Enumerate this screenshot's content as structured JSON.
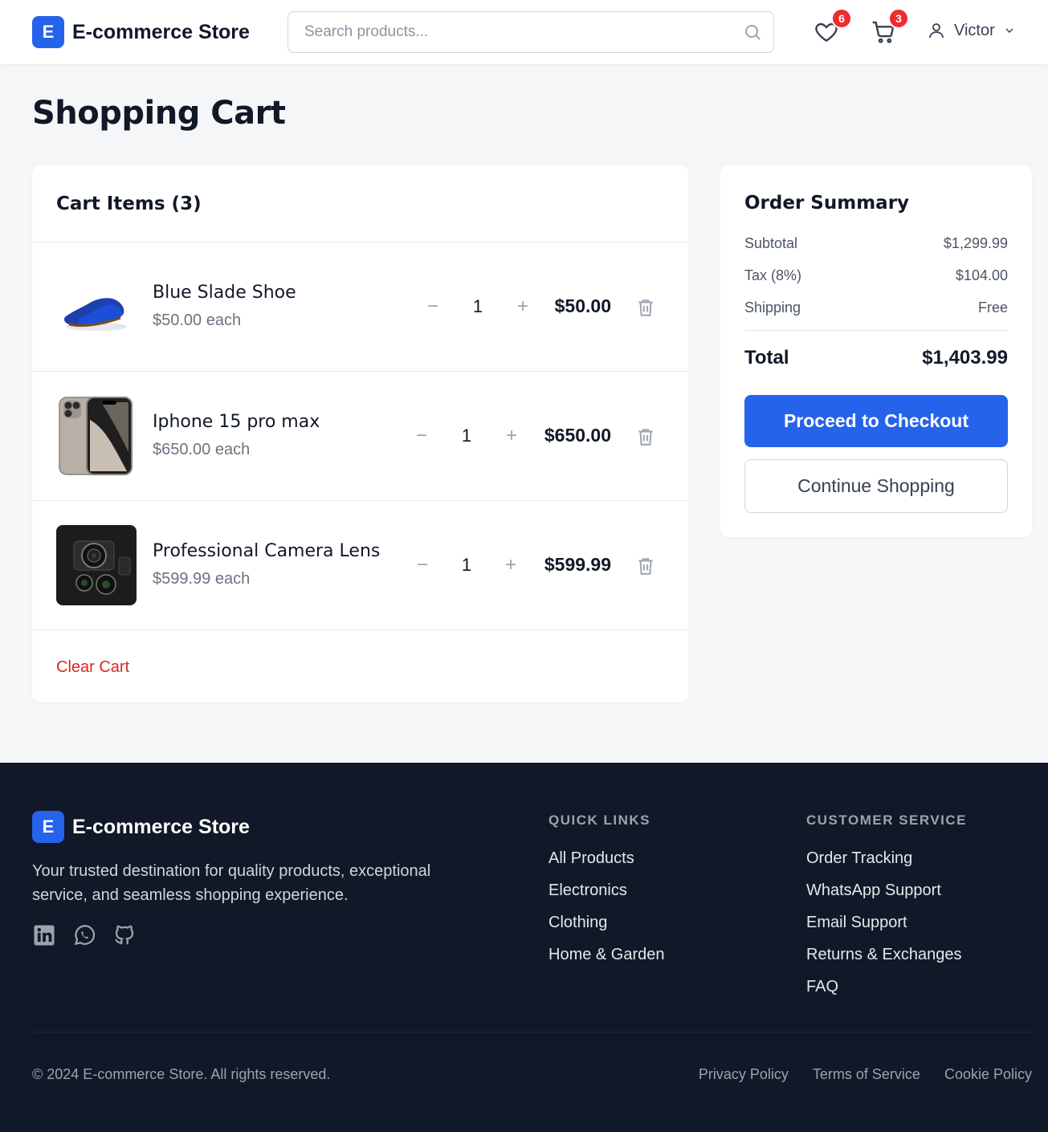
{
  "header": {
    "logo_letter": "E",
    "brand": "E-commerce Store",
    "search_placeholder": "Search products...",
    "wishlist_count": "6",
    "cart_count": "3",
    "user_name": "Victor",
    "accent": "#2563eb",
    "badge_color": "#ef2b2b"
  },
  "page_title": "Shopping Cart",
  "cart": {
    "heading": "Cart Items (3)",
    "items": [
      {
        "name": "Blue Slade Shoe",
        "unit_price": "$50.00 each",
        "quantity": "1",
        "total": "$50.00"
      },
      {
        "name": "Iphone 15 pro max",
        "unit_price": "$650.00 each",
        "quantity": "1",
        "total": "$650.00"
      },
      {
        "name": "Professional Camera Lens",
        "unit_price": "$599.99 each",
        "quantity": "1",
        "total": "$599.99"
      }
    ],
    "decrement_symbol": "−",
    "increment_symbol": "+",
    "clear_label": "Clear Cart"
  },
  "summary": {
    "title": "Order Summary",
    "subtotal_label": "Subtotal",
    "subtotal_value": "$1,299.99",
    "tax_label": "Tax (8%)",
    "tax_value": "$104.00",
    "shipping_label": "Shipping",
    "shipping_value": "Free",
    "total_label": "Total",
    "total_value": "$1,403.99",
    "checkout_label": "Proceed to Checkout",
    "continue_label": "Continue Shopping"
  },
  "footer": {
    "logo_letter": "E",
    "brand": "E-commerce Store",
    "description": "Your trusted destination for quality products, exceptional service, and seamless shopping experience.",
    "socials": [
      "linkedin-icon",
      "whatsapp-icon",
      "github-icon"
    ],
    "quick_links": {
      "title": "QUICK LINKS",
      "links": [
        "All Products",
        "Electronics",
        "Clothing",
        "Home & Garden"
      ]
    },
    "customer_service": {
      "title": "CUSTOMER SERVICE",
      "links": [
        "Order Tracking",
        "WhatsApp Support",
        "Email Support",
        "Returns & Exchanges",
        "FAQ"
      ]
    },
    "copyright": "© 2024 E-commerce Store. All rights reserved.",
    "legal": [
      "Privacy Policy",
      "Terms of Service",
      "Cookie Policy"
    ]
  }
}
